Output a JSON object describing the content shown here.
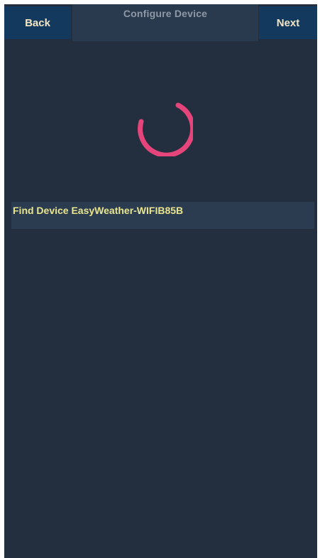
{
  "header": {
    "back_label": "Back",
    "title": "Configure Device",
    "next_label": "Next"
  },
  "status": {
    "text": "Find Device EasyWeather-WIFIB85B"
  },
  "colors": {
    "background": "#232f3f",
    "header_button": "#14395e",
    "spinner": "#e5457a",
    "status_text": "#e9e58e"
  },
  "icons": {
    "spinner": "loading-spinner-icon"
  }
}
